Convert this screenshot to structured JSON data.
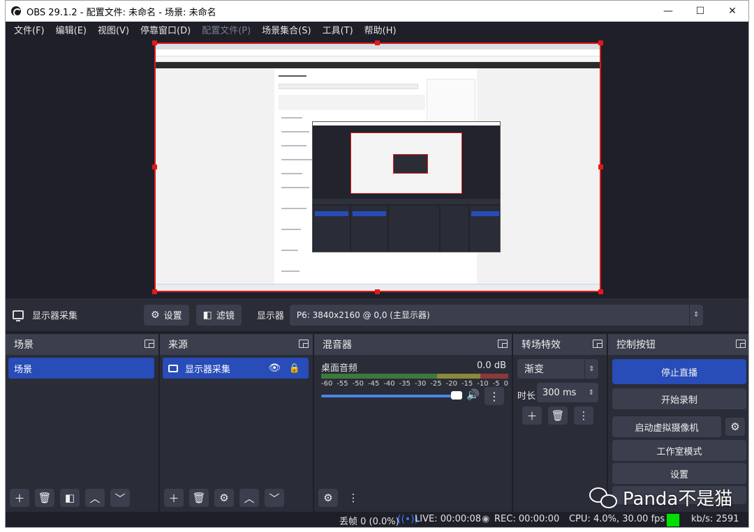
{
  "window": {
    "title": "OBS 29.1.2 - 配置文件: 未命名 - 场景: 未命名",
    "min": "—",
    "max": "☐",
    "close": "✕"
  },
  "menu": [
    "文件(F)",
    "编辑(E)",
    "视图(V)",
    "停靠窗口(D)",
    "配置文件(P)",
    "场景集合(S)",
    "工具(T)",
    "帮助(H)"
  ],
  "props": {
    "source_name": "显示器采集",
    "settings": "设置",
    "filters": "滤镜",
    "display_label": "显示器",
    "display_value": "P6: 3840x2160 @ 0,0 (主显示器)"
  },
  "scenes": {
    "title": "场景",
    "items": [
      "场景"
    ]
  },
  "sources": {
    "title": "来源",
    "items": [
      "显示器采集"
    ]
  },
  "mixer": {
    "title": "混音器",
    "channel": "桌面音频",
    "db": "0.0 dB",
    "scale": [
      "-60",
      "-55",
      "-50",
      "-45",
      "-40",
      "-35",
      "-30",
      "-25",
      "-20",
      "-15",
      "-10",
      "-5",
      "0"
    ],
    "volume_fraction": 0.98
  },
  "transitions": {
    "title": "转场特效",
    "selected": "渐变",
    "duration_label": "时长",
    "duration": "300 ms"
  },
  "controls": {
    "title": "控制按钮",
    "stop_stream": "停止直播",
    "start_record": "开始录制",
    "virtual_cam": "启动虚拟摄像机",
    "studio_mode": "工作室模式",
    "settings": "设置"
  },
  "status": {
    "dropped": "丢帧 0 (0.0%)",
    "live": "LIVE: 00:00:08",
    "rec": "REC: 00:00:00",
    "cpu": "CPU: 4.0%, 30.00 fps",
    "kbps": "kb/s: 2591"
  },
  "watermark": "Panda不是猫",
  "colors": {
    "accent": "#284cb8",
    "selection_border": "#e11a1a",
    "bg": "#1e1f28",
    "dock": "#2a2c37",
    "button": "#3b3e4c",
    "stream_health": "#00e000"
  }
}
